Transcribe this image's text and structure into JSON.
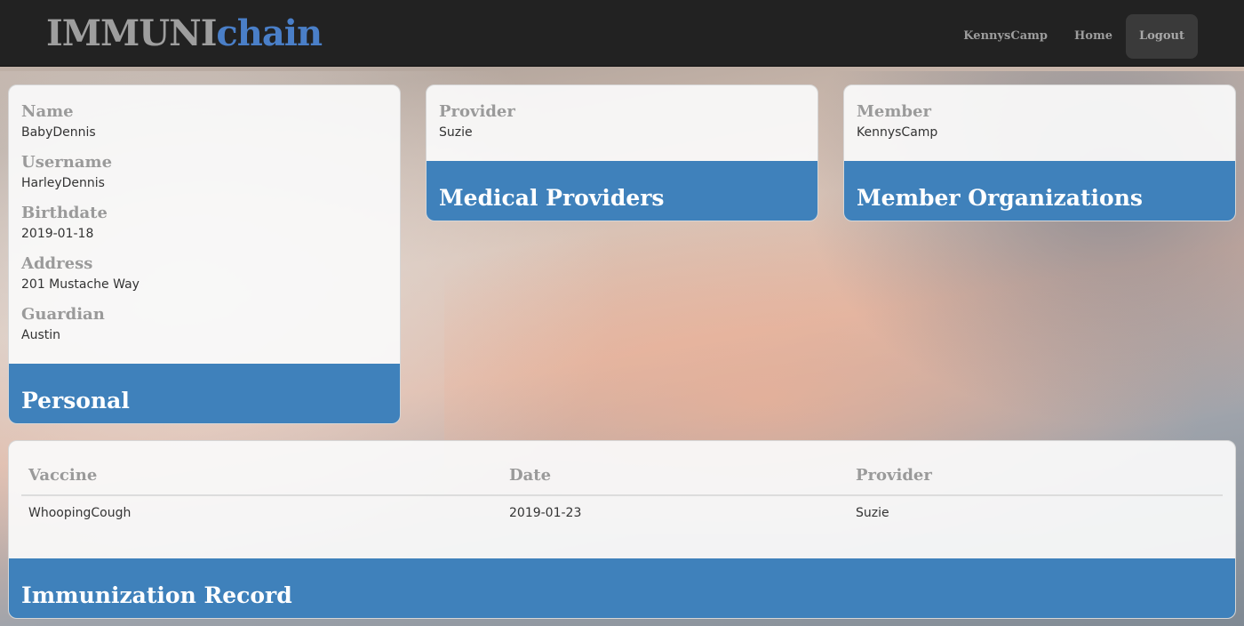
{
  "brand": {
    "part1": "IMMUNI",
    "part2": "chain"
  },
  "nav": {
    "user": "KennysCamp",
    "home": "Home",
    "logout": "Logout"
  },
  "personal": {
    "title": "Personal",
    "fields": [
      {
        "label": "Name",
        "value": "BabyDennis"
      },
      {
        "label": "Username",
        "value": "HarleyDennis"
      },
      {
        "label": "Birthdate",
        "value": "2019-01-18"
      },
      {
        "label": "Address",
        "value": "201 Mustache Way"
      },
      {
        "label": "Guardian",
        "value": "Austin"
      }
    ]
  },
  "providers": {
    "title": "Medical Providers",
    "label": "Provider",
    "value": "Suzie"
  },
  "members": {
    "title": "Member Organizations",
    "label": "Member",
    "value": "KennysCamp"
  },
  "record": {
    "title": "Immunization Record",
    "columns": [
      "Vaccine",
      "Date",
      "Provider"
    ],
    "rows": [
      [
        "WhoopingCough",
        "2019-01-23",
        "Suzie"
      ]
    ]
  }
}
